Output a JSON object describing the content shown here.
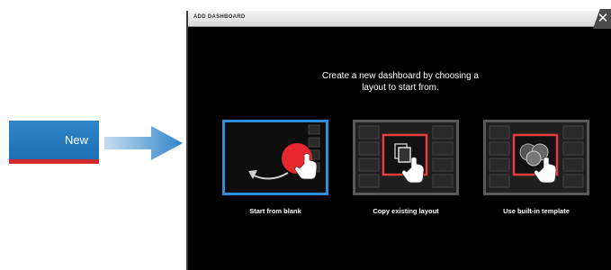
{
  "new_button": {
    "label": "New"
  },
  "dialog": {
    "title": "ADD DASHBOARD",
    "close_glyph": "✕",
    "prompt_line1": "Create a new dashboard by choosing a",
    "prompt_line2": "layout to start from.",
    "options": [
      {
        "label": "Start from blank",
        "icon": "blank-dashboard-icon",
        "selected": true
      },
      {
        "label": "Copy existing layout",
        "icon": "copy-layout-icon",
        "selected": false
      },
      {
        "label": "Use built-in template",
        "icon": "template-icon",
        "selected": false
      }
    ]
  },
  "colors": {
    "accent_blue": "#2f86c9",
    "highlight_red": "#e53b3b",
    "dialog_bg": "#000000"
  }
}
